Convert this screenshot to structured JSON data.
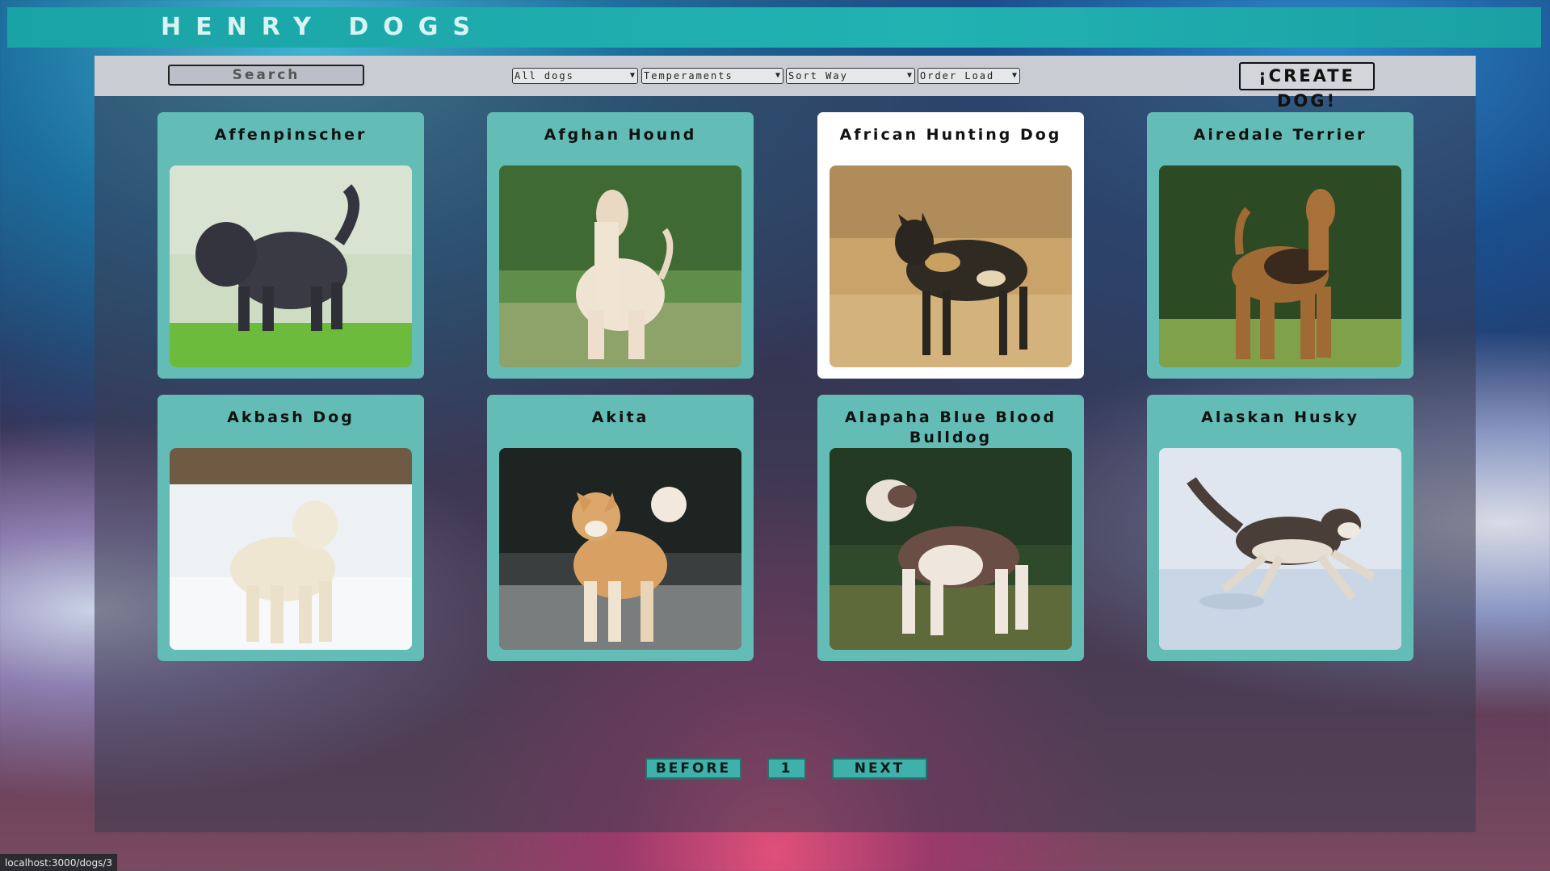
{
  "header": {
    "title": "HENRY DOGS"
  },
  "toolbar": {
    "search_placeholder": "Search",
    "filters": [
      "All dogs",
      "Temperaments",
      "Sort Way",
      "Order Load"
    ],
    "create_label": "¡CREATE DOG!"
  },
  "cards": [
    {
      "name": "Affenpinscher"
    },
    {
      "name": "Afghan Hound"
    },
    {
      "name": "African Hunting Dog"
    },
    {
      "name": "Airedale Terrier"
    },
    {
      "name": "Akbash Dog"
    },
    {
      "name": "Akita"
    },
    {
      "name": "Alapaha Blue Blood Bulldog"
    },
    {
      "name": "Alaskan Husky"
    }
  ],
  "pagination": {
    "before_label": "BEFORE",
    "page": "1",
    "next_label": "NEXT"
  },
  "status_url": "localhost:3000/dogs/3",
  "colors": {
    "header": "#1aa3a6",
    "card": "#63bdb6",
    "card_active": "#ffffff",
    "toolbar": "#c9ccd3",
    "pagination": "#3fb1aa"
  },
  "icons": {
    "select_arrow": "chevron-down-icon"
  }
}
